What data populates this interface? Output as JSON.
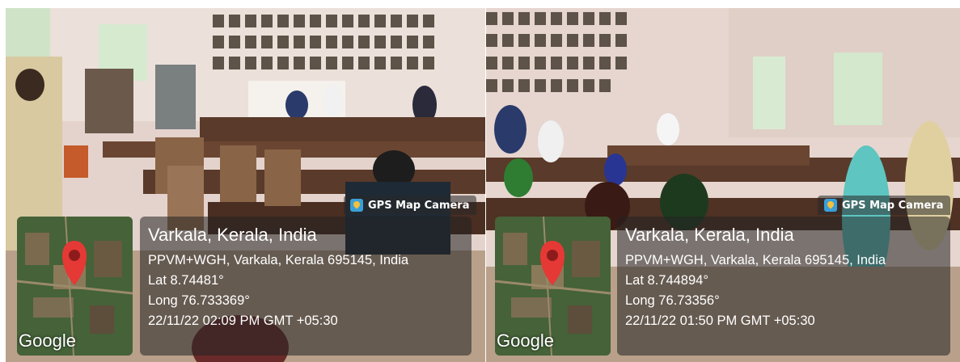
{
  "photos": [
    {
      "tag": "GPS Map Camera",
      "map_brand": "Google",
      "place": "Varkala, Kerala, India",
      "address": "PPVM+WGH, Varkala, Kerala 695145, India",
      "lat": "Lat 8.74481°",
      "long": "Long 76.733369°",
      "datetime": "22/11/22 02:09 PM GMT +05:30"
    },
    {
      "tag": "GPS Map Camera",
      "map_brand": "Google",
      "place": "Varkala, Kerala, India",
      "address": "PPVM+WGH, Varkala, Kerala 695145, India",
      "lat": "Lat 8.744894°",
      "long": "Long 76.73356°",
      "datetime": "22/11/22 01:50 PM GMT +05:30"
    }
  ],
  "colors": {
    "wall": "#e9dcd6",
    "bench": "#5a3a2a",
    "pin": "#e53935",
    "overlay": "#232323"
  }
}
